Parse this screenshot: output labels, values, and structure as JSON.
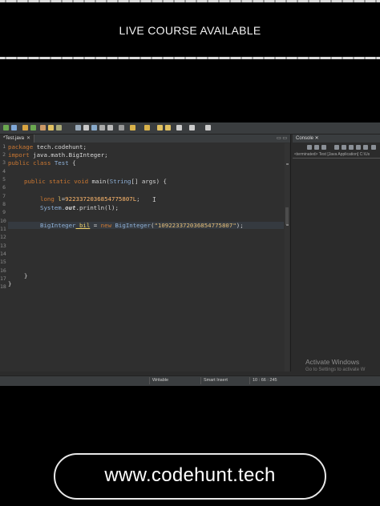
{
  "banner": {
    "title": "LIVE COURSE AVAILABLE"
  },
  "editor": {
    "tab_label": "*Test.java",
    "tab_close": "✕",
    "ctrls": "▭ ▭",
    "line_numbers": [
      "1",
      "2",
      "3",
      "4",
      "5",
      "6",
      "7",
      "8",
      "9",
      "10",
      "11",
      "12",
      "13",
      "14",
      "15",
      "16",
      "17",
      "18"
    ],
    "code": {
      "l1_kw": "package",
      "l1_rest": " tech.codehunt;",
      "l2_kw": "import",
      "l2_rest": " java.math.BigInteger;",
      "l3_kw": "public class",
      "l3_cls": " Test",
      "l3_rest": " {",
      "l5_kw": "public static void",
      "l5_rest": " main(",
      "l5_cls": "String",
      "l5_rest2": "[] args) {",
      "l7_kw": "long",
      "l7_var": " l",
      "l7_eq": "=",
      "l7_num": "9223372036854775807L",
      "l7_end": ";",
      "l8_pre": "System.",
      "l8_out": "out",
      "l8_dot": ".println(l);",
      "l10_cls": "BigInteger",
      "l10_var": " bil",
      "l10_mid": " = ",
      "l10_kw": "new",
      "l10_cls2": " BigInteger",
      "l10_open": "(",
      "l10_str": "\"109223372036854775807\"",
      "l10_end": ");",
      "l15_brace": "}",
      "l16_brace": "}"
    },
    "caret": "I"
  },
  "console": {
    "tab_label": "Console ✕",
    "status": "<terminated> Test [Java Application] C:\\Us",
    "activate_title": "Activate Windows",
    "activate_sub": "Go to Settings to activate W"
  },
  "statusbar": {
    "writable": "Writable",
    "insert_mode": "Smart Insert",
    "position": "10 : 66 : 245"
  },
  "footer": {
    "url": "www.codehunt.tech"
  },
  "colors": {
    "keyword": "#cc7832",
    "string": "#e6c07b",
    "background": "#000000"
  }
}
